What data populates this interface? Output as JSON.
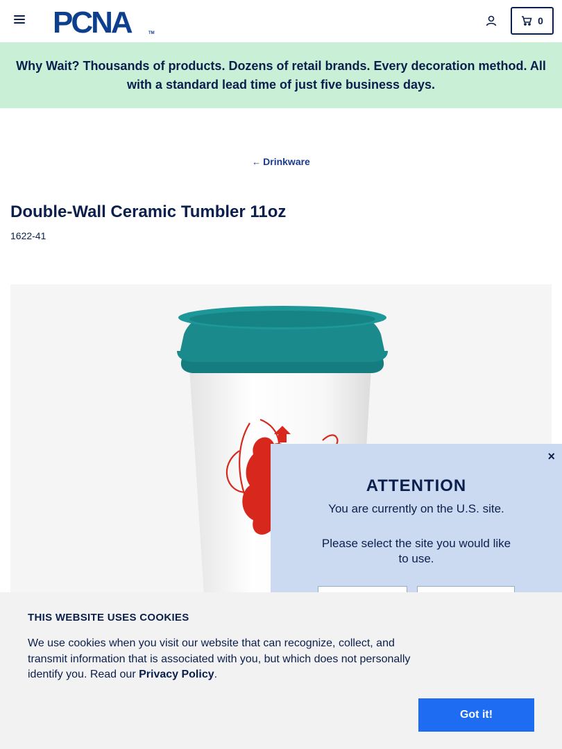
{
  "header": {
    "logo_text": "PCNA",
    "logo_tm": "TM",
    "cart_count": "0"
  },
  "promo": {
    "text": "Why Wait? Thousands of products. Dozens of retail brands. Every decoration method. All with a standard lead time of just five business days."
  },
  "breadcrumb": {
    "back_label": "Drinkware"
  },
  "product": {
    "title": "Double-Wall Ceramic Tumbler 11oz",
    "sku": "1622-41",
    "lid_color": "#1a8a8c",
    "print_color": "#d8281e"
  },
  "site_modal": {
    "close_label": "×",
    "title": "ATTENTION",
    "line1": "You are currently on the U.S. site.",
    "line2": "Please select the site you would like to use."
  },
  "cookie_banner": {
    "title": "THIS WEBSITE USES COOKIES",
    "text_before": "We use cookies when you visit our website that can recognize, collect, and transmit information that is associated with you, but which does not personally identify you. Read our ",
    "link_label": "Privacy Policy",
    "text_after": ".",
    "accept_label": "Got it!"
  },
  "colors": {
    "navy": "#0b1f4d",
    "promo_bg": "#c9f0d6",
    "modal_bg": "#ccdaf1",
    "accent_blue": "#1e6cf2"
  }
}
